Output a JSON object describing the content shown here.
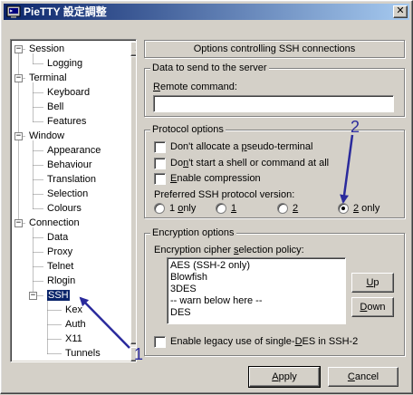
{
  "window": {
    "title": "PieTTY 設定調整",
    "close_glyph": "✕"
  },
  "tree": {
    "items": [
      {
        "label": "Session",
        "level": 0,
        "expanded": true
      },
      {
        "label": "Logging",
        "level": 1
      },
      {
        "label": "Terminal",
        "level": 0,
        "expanded": true
      },
      {
        "label": "Keyboard",
        "level": 1
      },
      {
        "label": "Bell",
        "level": 1
      },
      {
        "label": "Features",
        "level": 1
      },
      {
        "label": "Window",
        "level": 0,
        "expanded": true
      },
      {
        "label": "Appearance",
        "level": 1
      },
      {
        "label": "Behaviour",
        "level": 1
      },
      {
        "label": "Translation",
        "level": 1
      },
      {
        "label": "Selection",
        "level": 1
      },
      {
        "label": "Colours",
        "level": 1
      },
      {
        "label": "Connection",
        "level": 0,
        "expanded": true
      },
      {
        "label": "Data",
        "level": 1
      },
      {
        "label": "Proxy",
        "level": 1
      },
      {
        "label": "Telnet",
        "level": 1
      },
      {
        "label": "Rlogin",
        "level": 1
      },
      {
        "label": "SSH",
        "level": 1,
        "expanded": true,
        "selected": true
      },
      {
        "label": "Kex",
        "level": 2
      },
      {
        "label": "Auth",
        "level": 2
      },
      {
        "label": "X11",
        "level": 2
      },
      {
        "label": "Tunnels",
        "level": 2
      }
    ],
    "expander_minus": "−"
  },
  "panel": {
    "header": "Options controlling SSH connections",
    "data_group": {
      "title": "Data to send to the server",
      "remote_command_label_first": "R",
      "remote_command_label_rest": "emote command:",
      "remote_command_value": ""
    },
    "protocol_group": {
      "title": "Protocol options",
      "options": [
        {
          "pre": "Don't allocate a ",
          "u": "p",
          "post": "seudo-terminal",
          "checked": false
        },
        {
          "pre": "Do",
          "u": "n",
          "post": "'t start a shell or command at all",
          "checked": false
        },
        {
          "pre": "",
          "u": "E",
          "post": "nable compression",
          "checked": false
        }
      ],
      "version_label": "Preferred SSH protocol version:",
      "versions": [
        {
          "pre": "1 ",
          "u": "o",
          "post": "nly",
          "checked": false
        },
        {
          "pre": "",
          "u": "1",
          "post": "",
          "checked": false
        },
        {
          "pre": "",
          "u": "2",
          "post": "",
          "checked": false
        },
        {
          "pre": "",
          "u": "2",
          "post": " only",
          "checked": true
        }
      ]
    },
    "encryption_group": {
      "title": "Encryption options",
      "policy_label_pre": "Encryption cipher ",
      "policy_label_u": "s",
      "policy_label_post": "election policy:",
      "ciphers": [
        "AES (SSH-2 only)",
        "Blowfish",
        "3DES",
        "-- warn below here --",
        "DES"
      ],
      "up_pre": "",
      "up_u": "U",
      "up_post": "p",
      "down_pre": "",
      "down_u": "D",
      "down_post": "own",
      "legacy_pre": "Enable legacy use of single-",
      "legacy_u": "D",
      "legacy_post": "ES in SSH-2",
      "legacy_checked": false
    }
  },
  "buttons": {
    "apply_u": "A",
    "apply_post": "pply",
    "cancel_u": "C",
    "cancel_post": "ancel"
  },
  "annotations": {
    "marker_1": "1",
    "marker_2": "2",
    "color": "#2a2a9c"
  }
}
